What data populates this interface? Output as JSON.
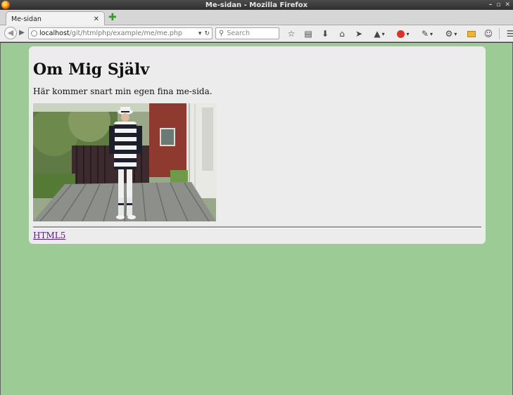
{
  "window": {
    "title": "Me-sidan - Mozilla Firefox",
    "controls": [
      "–",
      "▫",
      "✕"
    ]
  },
  "tabs": [
    {
      "label": "Me-sidan",
      "active": true
    }
  ],
  "navbar": {
    "url_host": "localhost",
    "url_path": "/git/htmlphp/example/me/me.php",
    "search_placeholder": "Search",
    "icons": [
      "star-icon",
      "reading-list-icon",
      "download-icon",
      "home-icon",
      "send-icon",
      "addon-icon",
      "abp-icon",
      "eyedropper-icon",
      "tools-icon",
      "reader-icon",
      "chat-icon",
      "menu-icon"
    ]
  },
  "page": {
    "heading": "Om Mig Själv",
    "intro": "Här kommer snart min egen fina me-sida.",
    "footer_link": "HTML5",
    "background_color": "#9dcb96",
    "card_color": "#ececec"
  }
}
